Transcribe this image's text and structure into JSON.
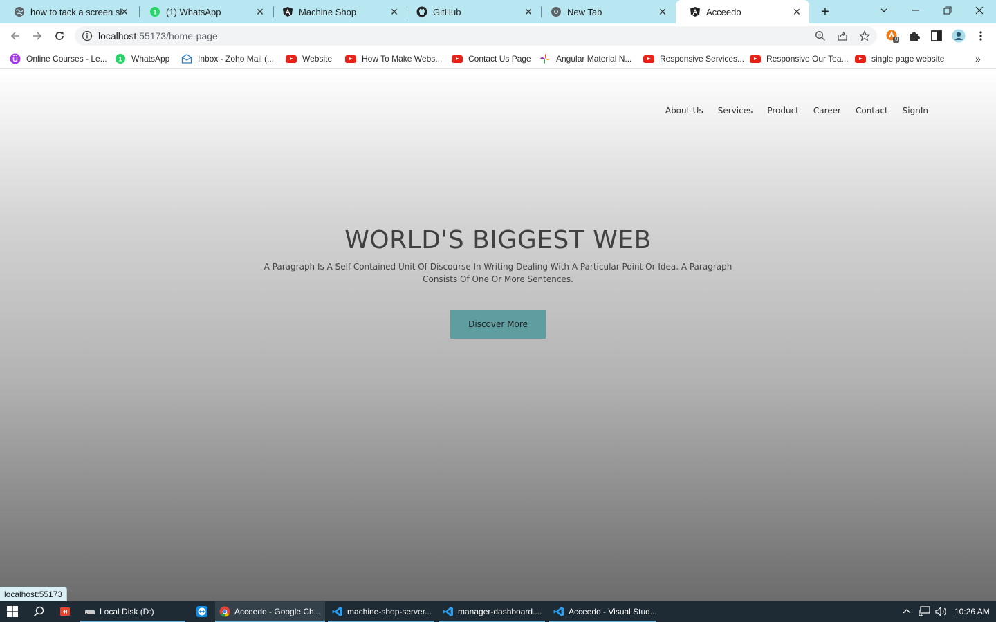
{
  "browser": {
    "tabs": [
      {
        "title": "how to tack a screen sho",
        "icon": "globe-icon"
      },
      {
        "title": "(1) WhatsApp",
        "icon": "whatsapp-icon"
      },
      {
        "title": "Machine Shop",
        "icon": "angular-icon"
      },
      {
        "title": "GitHub",
        "icon": "github-icon"
      },
      {
        "title": "New Tab",
        "icon": "chrome-icon"
      },
      {
        "title": "Acceedo",
        "icon": "angular-icon",
        "active": true
      }
    ],
    "url_host": "localhost",
    "url_rest": ":55173/home-page",
    "extension_badge": "0",
    "bookmarks": [
      {
        "label": "Online Courses - Le...",
        "icon": "udemy-icon"
      },
      {
        "label": "WhatsApp",
        "icon": "whatsapp-icon"
      },
      {
        "label": "Inbox - Zoho Mail (...",
        "icon": "mail-icon"
      },
      {
        "label": "Website",
        "icon": "youtube-icon"
      },
      {
        "label": "How To Make Webs...",
        "icon": "youtube-icon"
      },
      {
        "label": "Contact Us Page",
        "icon": "youtube-icon"
      },
      {
        "label": "Angular Material N...",
        "icon": "pinwheel-icon"
      },
      {
        "label": "Responsive Services...",
        "icon": "youtube-icon"
      },
      {
        "label": "Responsive Our Tea...",
        "icon": "youtube-icon"
      },
      {
        "label": "single page website",
        "icon": "youtube-icon"
      }
    ]
  },
  "site": {
    "nav": [
      "About-Us",
      "Services",
      "Product",
      "Career",
      "Contact",
      "SignIn"
    ],
    "hero_title": "WORLD'S BIGGEST WEB",
    "hero_text": "A Paragraph Is A Self-Contained Unit Of Discourse In Writing Dealing With A Particular Point Or Idea. A Paragraph Consists Of One Or More Sentences.",
    "cta_label": "Discover More"
  },
  "status_tooltip": "localhost:55173",
  "taskbar": {
    "apps": [
      {
        "label": "Local Disk (D:)",
        "icon": "drive-icon"
      },
      {
        "label": "Acceedo - Google Ch...",
        "icon": "chrome-icon",
        "active": true
      },
      {
        "label": "machine-shop-server...",
        "icon": "vscode-icon"
      },
      {
        "label": "manager-dashboard....",
        "icon": "vscode-icon"
      },
      {
        "label": "Acceedo - Visual Stud...",
        "icon": "vscode-icon"
      }
    ],
    "clock": "10:26 AM"
  },
  "colors": {
    "tabstrip_bg": "#b9e7f1",
    "cta_bg": "#5f9ea0",
    "taskbar_bg": "#1f2b34"
  }
}
